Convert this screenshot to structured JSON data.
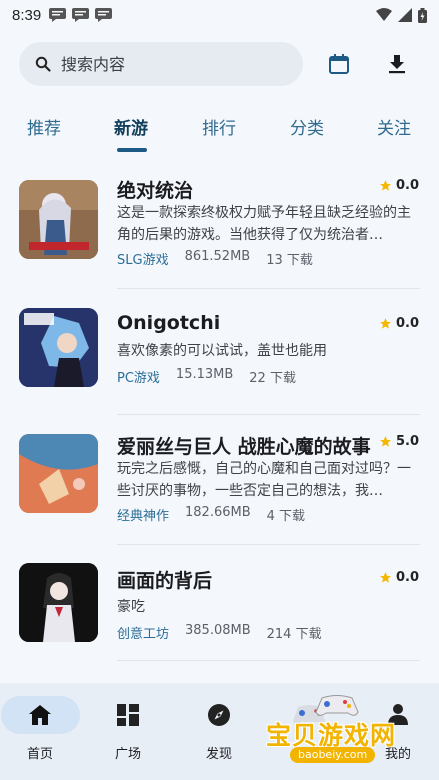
{
  "status_bar": {
    "time": "8:39"
  },
  "search": {
    "placeholder": "搜索内容"
  },
  "tabs": [
    {
      "label": "推荐",
      "active": false
    },
    {
      "label": "新游",
      "active": true
    },
    {
      "label": "排行",
      "active": false
    },
    {
      "label": "分类",
      "active": false
    },
    {
      "label": "关注",
      "active": false
    }
  ],
  "games": [
    {
      "title": "绝对统治",
      "rating": "0.0",
      "description": "这是一款探索终极权力赋予年轻且缺乏经验的主角的后果的游戏。当他获得了仅为统治者…",
      "category": "SLG游戏",
      "size": "861.52MB",
      "downloads": "13 下载"
    },
    {
      "title": "Onigotchi",
      "rating": "0.0",
      "description": "喜欢像素的可以试试，盖世也能用",
      "category": "PC游戏",
      "size": "15.13MB",
      "downloads": "22 下载"
    },
    {
      "title": "爱丽丝与巨人 战胜心魔的故事",
      "rating": "5.0",
      "description": "玩完之后感慨，自己的心魔和自己面对过吗？一些讨厌的事物，一些否定自己的想法，我…",
      "category": "经典神作",
      "size": "182.66MB",
      "downloads": "4 下载"
    },
    {
      "title": "画面的背后",
      "rating": "0.0",
      "description": "豪吃",
      "category": "创意工坊",
      "size": "385.08MB",
      "downloads": "214 下载"
    }
  ],
  "bottom_nav": [
    {
      "label": "首页",
      "icon": "home-icon",
      "active": true
    },
    {
      "label": "广场",
      "icon": "grid-icon",
      "active": false
    },
    {
      "label": "发现",
      "icon": "compass-icon",
      "active": false
    },
    {
      "label": "",
      "icon": "gamepad-icon",
      "active": false
    },
    {
      "label": "我的",
      "icon": "person-icon",
      "active": false
    }
  ],
  "watermark": {
    "text": "宝贝游戏网",
    "url": "baobeiy.com"
  },
  "colors": {
    "accent": "#1d5b86",
    "star": "#f5b800",
    "background": "#f4f8fc",
    "nav_background": "#e8eef5"
  }
}
